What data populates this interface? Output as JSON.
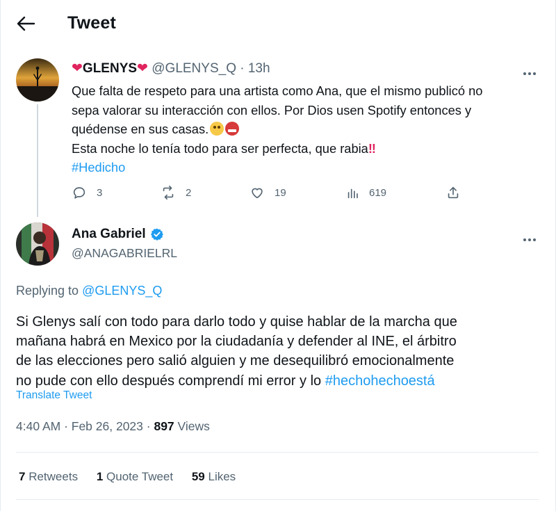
{
  "header": {
    "title": "Tweet"
  },
  "parent_tweet": {
    "display_name": "GLENYS",
    "handle": "@GLENYS_Q",
    "separator": "·",
    "time": "13h",
    "lines": [
      "Que falta de respeto para una artista como Ana, que el mismo publicó no",
      "sepa valorar su interacción con ellos. Por Dios usen Spotify entonces y",
      "quédense en sus casas.",
      "Esta noche lo tenía todo para ser perfecta, que rabia"
    ],
    "emphasis": "‼",
    "hashtag": "#Hedicho",
    "actions": {
      "replies": "3",
      "retweets": "2",
      "likes": "19",
      "views": "619"
    }
  },
  "main_tweet": {
    "display_name": "Ana Gabriel",
    "handle": "@ANAGABRIELRL",
    "replying_prefix": "Replying to",
    "replying_to": "@GLENYS_Q",
    "lines": [
      "Si Glenys salí con todo para darlo todo y quise hablar de la marcha que",
      "mañana habrá en Mexico por la ciudadanía y defender al INE, el árbitro",
      "de las elecciones pero salió alguien y me desequilibró emocionalmente",
      "no pude con ello después comprendí mi error y lo"
    ],
    "hashtag": "#hechohechoestá",
    "translate": "Translate Tweet",
    "timestamp": "4:40 AM · Feb 26, 2023 ·",
    "views_count": "897",
    "views_label": "Views",
    "stats": {
      "retweets_count": "7",
      "retweets_label": "Retweets",
      "quotes_count": "1",
      "quotes_label": "Quote Tweet",
      "likes_count": "59",
      "likes_label": "Likes"
    }
  },
  "colors": {
    "text": "#0f1419",
    "muted": "#536471",
    "link": "#1d9bf0",
    "heart": "#e0245e",
    "divider": "#e6ecf0"
  }
}
